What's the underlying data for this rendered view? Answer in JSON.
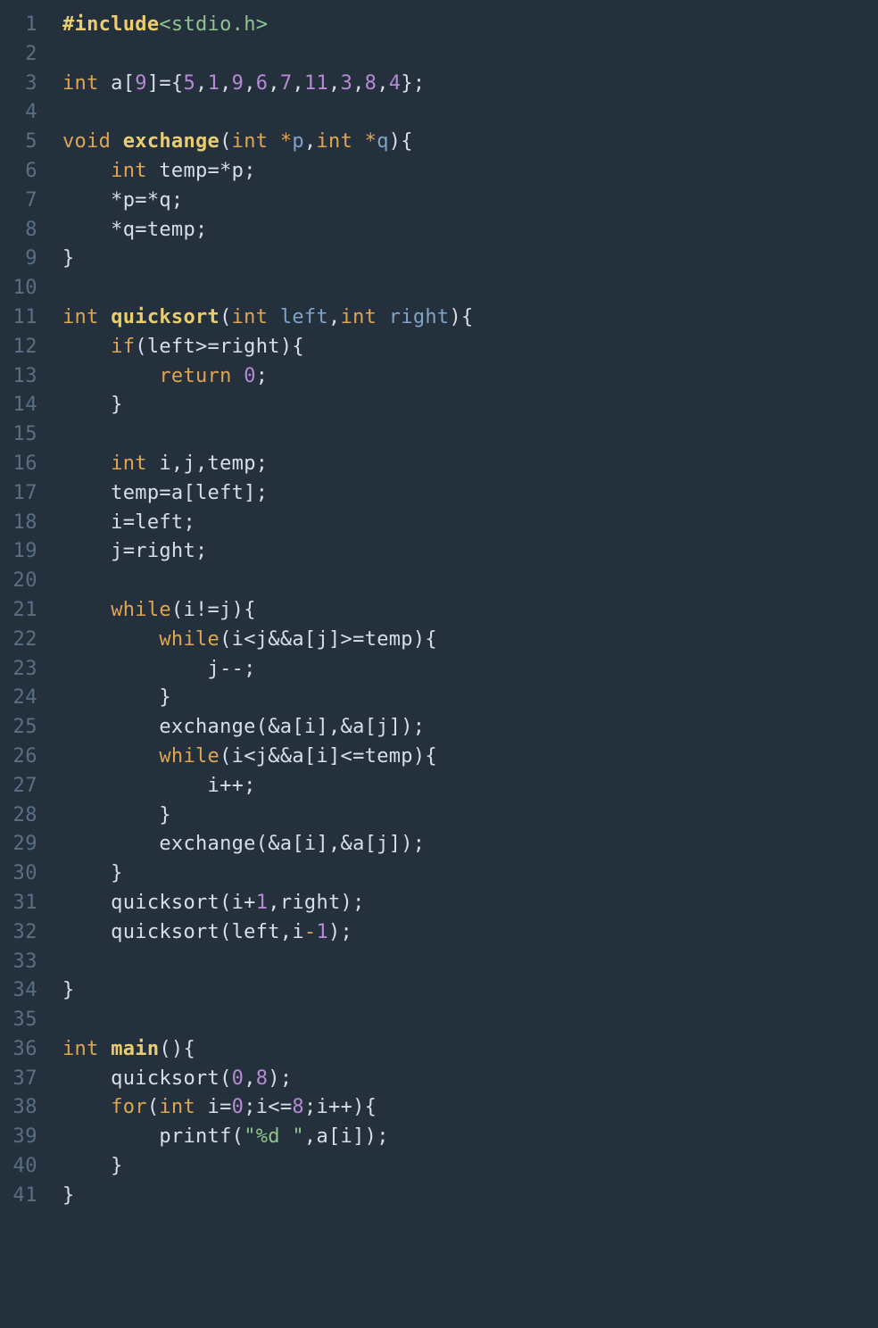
{
  "language": "c",
  "line_count": 41,
  "lines": [
    [
      {
        "t": "#include",
        "c": "c-pre"
      },
      {
        "t": "<stdio.h>",
        "c": "c-str"
      }
    ],
    [],
    [
      {
        "t": "int",
        "c": "c-kw"
      },
      {
        "t": " a[",
        "c": "c-plain"
      },
      {
        "t": "9",
        "c": "c-num"
      },
      {
        "t": "]={",
        "c": "c-plain"
      },
      {
        "t": "5",
        "c": "c-num"
      },
      {
        "t": ",",
        "c": "c-plain"
      },
      {
        "t": "1",
        "c": "c-num"
      },
      {
        "t": ",",
        "c": "c-plain"
      },
      {
        "t": "9",
        "c": "c-num"
      },
      {
        "t": ",",
        "c": "c-plain"
      },
      {
        "t": "6",
        "c": "c-num"
      },
      {
        "t": ",",
        "c": "c-plain"
      },
      {
        "t": "7",
        "c": "c-num"
      },
      {
        "t": ",",
        "c": "c-plain"
      },
      {
        "t": "11",
        "c": "c-num"
      },
      {
        "t": ",",
        "c": "c-plain"
      },
      {
        "t": "3",
        "c": "c-num"
      },
      {
        "t": ",",
        "c": "c-plain"
      },
      {
        "t": "8",
        "c": "c-num"
      },
      {
        "t": ",",
        "c": "c-plain"
      },
      {
        "t": "4",
        "c": "c-num"
      },
      {
        "t": "};",
        "c": "c-plain"
      }
    ],
    [],
    [
      {
        "t": "void",
        "c": "c-kw"
      },
      {
        "t": " ",
        "c": "c-plain"
      },
      {
        "t": "exchange",
        "c": "c-id"
      },
      {
        "t": "(",
        "c": "c-plain"
      },
      {
        "t": "int",
        "c": "c-kw"
      },
      {
        "t": " ",
        "c": "c-plain"
      },
      {
        "t": "*",
        "c": "c-op"
      },
      {
        "t": "p",
        "c": "c-param"
      },
      {
        "t": ",",
        "c": "c-plain"
      },
      {
        "t": "int",
        "c": "c-kw"
      },
      {
        "t": " ",
        "c": "c-plain"
      },
      {
        "t": "*",
        "c": "c-op"
      },
      {
        "t": "q",
        "c": "c-param"
      },
      {
        "t": "){",
        "c": "c-plain"
      }
    ],
    [
      {
        "t": "    ",
        "c": "c-plain"
      },
      {
        "t": "int",
        "c": "c-kw"
      },
      {
        "t": " temp=*p;",
        "c": "c-plain"
      }
    ],
    [
      {
        "t": "    *p=*q;",
        "c": "c-plain"
      }
    ],
    [
      {
        "t": "    *q=temp;",
        "c": "c-plain"
      }
    ],
    [
      {
        "t": "}",
        "c": "c-plain"
      }
    ],
    [],
    [
      {
        "t": "int",
        "c": "c-kw"
      },
      {
        "t": " ",
        "c": "c-plain"
      },
      {
        "t": "quicksort",
        "c": "c-id"
      },
      {
        "t": "(",
        "c": "c-plain"
      },
      {
        "t": "int",
        "c": "c-kw"
      },
      {
        "t": " ",
        "c": "c-plain"
      },
      {
        "t": "left",
        "c": "c-param"
      },
      {
        "t": ",",
        "c": "c-plain"
      },
      {
        "t": "int",
        "c": "c-kw"
      },
      {
        "t": " ",
        "c": "c-plain"
      },
      {
        "t": "right",
        "c": "c-param"
      },
      {
        "t": "){",
        "c": "c-plain"
      }
    ],
    [
      {
        "t": "    ",
        "c": "c-plain"
      },
      {
        "t": "if",
        "c": "c-kw"
      },
      {
        "t": "(left>=right){",
        "c": "c-plain"
      }
    ],
    [
      {
        "t": "        ",
        "c": "c-plain"
      },
      {
        "t": "return",
        "c": "c-kw"
      },
      {
        "t": " ",
        "c": "c-plain"
      },
      {
        "t": "0",
        "c": "c-num"
      },
      {
        "t": ";",
        "c": "c-plain"
      }
    ],
    [
      {
        "t": "    }",
        "c": "c-plain"
      }
    ],
    [],
    [
      {
        "t": "    ",
        "c": "c-plain"
      },
      {
        "t": "int",
        "c": "c-kw"
      },
      {
        "t": " i,j,temp;",
        "c": "c-plain"
      }
    ],
    [
      {
        "t": "    temp=a[left];",
        "c": "c-plain"
      }
    ],
    [
      {
        "t": "    i=left;",
        "c": "c-plain"
      }
    ],
    [
      {
        "t": "    j=right;",
        "c": "c-plain"
      }
    ],
    [],
    [
      {
        "t": "    ",
        "c": "c-plain"
      },
      {
        "t": "while",
        "c": "c-kw"
      },
      {
        "t": "(i!=j){",
        "c": "c-plain"
      }
    ],
    [
      {
        "t": "        ",
        "c": "c-plain"
      },
      {
        "t": "while",
        "c": "c-kw"
      },
      {
        "t": "(i<j&&a[j]>=temp){",
        "c": "c-plain"
      }
    ],
    [
      {
        "t": "            j--;",
        "c": "c-plain"
      }
    ],
    [
      {
        "t": "        }",
        "c": "c-plain"
      }
    ],
    [
      {
        "t": "        exchange(&a[i],&a[j]);",
        "c": "c-plain"
      }
    ],
    [
      {
        "t": "        ",
        "c": "c-plain"
      },
      {
        "t": "while",
        "c": "c-kw"
      },
      {
        "t": "(i<j&&a[i]<=temp){",
        "c": "c-plain"
      }
    ],
    [
      {
        "t": "            i++;",
        "c": "c-plain"
      }
    ],
    [
      {
        "t": "        }",
        "c": "c-plain"
      }
    ],
    [
      {
        "t": "        exchange(&a[i],&a[j]);",
        "c": "c-plain"
      }
    ],
    [
      {
        "t": "    }",
        "c": "c-plain"
      }
    ],
    [
      {
        "t": "    quicksort(i+",
        "c": "c-plain"
      },
      {
        "t": "1",
        "c": "c-num"
      },
      {
        "t": ",right);",
        "c": "c-plain"
      }
    ],
    [
      {
        "t": "    quicksort(left,i",
        "c": "c-plain"
      },
      {
        "t": "-",
        "c": "c-op"
      },
      {
        "t": "1",
        "c": "c-num"
      },
      {
        "t": ");",
        "c": "c-plain"
      }
    ],
    [],
    [
      {
        "t": "}",
        "c": "c-plain"
      }
    ],
    [],
    [
      {
        "t": "int",
        "c": "c-kw"
      },
      {
        "t": " ",
        "c": "c-plain"
      },
      {
        "t": "main",
        "c": "c-id"
      },
      {
        "t": "(){",
        "c": "c-plain"
      }
    ],
    [
      {
        "t": "    quicksort(",
        "c": "c-plain"
      },
      {
        "t": "0",
        "c": "c-num"
      },
      {
        "t": ",",
        "c": "c-plain"
      },
      {
        "t": "8",
        "c": "c-num"
      },
      {
        "t": ");",
        "c": "c-plain"
      }
    ],
    [
      {
        "t": "    ",
        "c": "c-plain"
      },
      {
        "t": "for",
        "c": "c-kw"
      },
      {
        "t": "(",
        "c": "c-plain"
      },
      {
        "t": "int",
        "c": "c-kw"
      },
      {
        "t": " i=",
        "c": "c-plain"
      },
      {
        "t": "0",
        "c": "c-num"
      },
      {
        "t": ";i<=",
        "c": "c-plain"
      },
      {
        "t": "8",
        "c": "c-num"
      },
      {
        "t": ";i++){",
        "c": "c-plain"
      }
    ],
    [
      {
        "t": "        printf(",
        "c": "c-plain"
      },
      {
        "t": "\"%d \"",
        "c": "c-str"
      },
      {
        "t": ",a[i]);",
        "c": "c-plain"
      }
    ],
    [
      {
        "t": "    }",
        "c": "c-plain"
      }
    ],
    [
      {
        "t": "}",
        "c": "c-plain"
      }
    ]
  ]
}
